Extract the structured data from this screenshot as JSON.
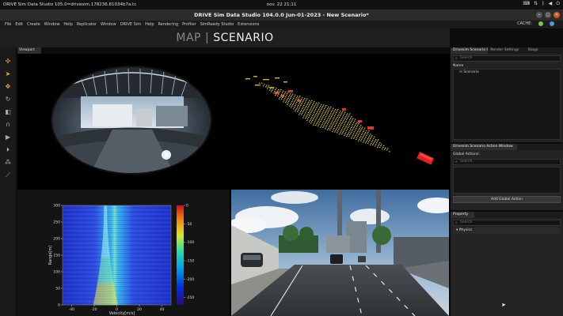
{
  "os": {
    "app_title": "DRIVE Sim Data Studio 105.0=drivesim.178236.81034b7a.tc",
    "clock": "nov. 22  21:11"
  },
  "window": {
    "title": "DRIVE Sim Data Studio 104.0.0 Jun-01-2023 - New Scenario*",
    "cache_label": "CACHE:"
  },
  "menu": [
    "File",
    "Edit",
    "Create",
    "Window",
    "Help",
    "Replicator",
    "Window",
    "DRIVE Sim",
    "Help",
    "Rendering",
    "Profiler",
    "SimReady Studio",
    "Extensions"
  ],
  "mode": {
    "map": "MAP",
    "separator": "|",
    "scenario": "SCENARIO"
  },
  "viewport": {
    "tab": "Viewport"
  },
  "outliner": {
    "tabs": [
      "Drivesim Scenario Outliner",
      "Render Settings",
      "Stage"
    ],
    "search_placeholder": "Search",
    "column_name": "Name",
    "root_item": "Scenario"
  },
  "action_window": {
    "tab": "Drivesim Scenario Action Window",
    "global_actions_label": "Global Actions:",
    "search_placeholder": "Search",
    "add_button": "Add Global Action"
  },
  "property": {
    "tab": "Property",
    "search_placeholder": "Search",
    "section": "Physics"
  },
  "colors": {
    "accent": "#e8a84a",
    "close_button": "#d6551c",
    "cache_green": "#7ec542",
    "cache_blue": "#3fa0e6"
  },
  "chart_data": {
    "type": "heatmap",
    "xlabel": "Velocity[m/s]",
    "ylabel": "Range[m]",
    "x_ticks": [
      -40,
      -20,
      0,
      20,
      40
    ],
    "y_ticks": [
      0,
      50,
      100,
      150,
      200,
      250,
      300
    ],
    "xlim": [
      -48,
      48
    ],
    "ylim": [
      0,
      300
    ],
    "colorbar_ticks": [
      0,
      -50,
      -100,
      -150,
      -200,
      -250
    ],
    "colorbar_range": [
      -270,
      0
    ],
    "peak_velocity": -10
  }
}
